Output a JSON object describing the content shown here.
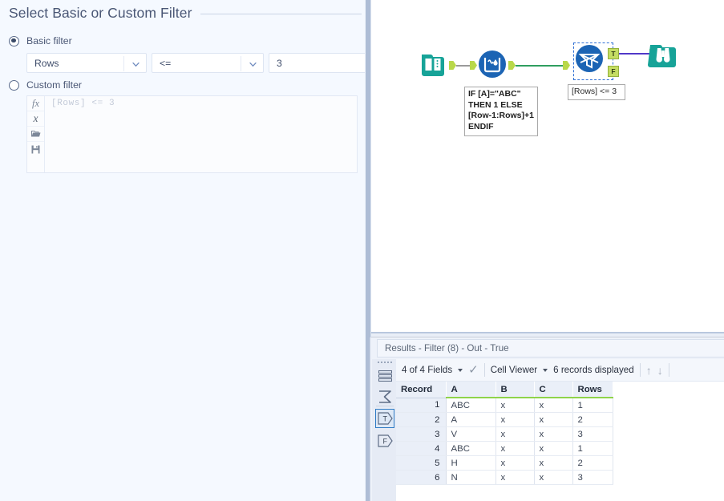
{
  "config_panel": {
    "section_title": "Select Basic or Custom Filter",
    "basic_radio_label": "Basic filter",
    "custom_radio_label": "Custom filter",
    "basic_filter": {
      "field": "Rows",
      "operator": "<=",
      "value": "3"
    },
    "custom_filter": {
      "expression_placeholder": "[Rows]  <=  3",
      "tools": [
        {
          "name": "fx-function-icon",
          "glyph": "fx"
        },
        {
          "name": "x-variable-icon",
          "glyph": "x"
        },
        {
          "name": "open-folder-icon",
          "glyph": "folder"
        },
        {
          "name": "save-disk-icon",
          "glyph": "disk"
        }
      ]
    }
  },
  "canvas": {
    "nodes": [
      {
        "id": "input-data",
        "icon": "input-data-book-icon",
        "color": "#17a398"
      },
      {
        "id": "multi-row-formula",
        "icon": "multi-row-formula-icon",
        "color": "#1c64b4"
      },
      {
        "id": "filter",
        "icon": "filter-funnel-icon",
        "color": "#1c64b4",
        "selected": true
      },
      {
        "id": "browse",
        "icon": "browse-binoculars-icon",
        "color": "#17a398"
      }
    ],
    "annotations": {
      "multi_row_formula": "IF [A]=\"ABC\"\nTHEN 1 ELSE\n[Row-1:Rows]+1\nENDIF",
      "filter": "[Rows] <= 3"
    },
    "filter_outputs": {
      "true_label": "T",
      "false_label": "F"
    }
  },
  "results": {
    "title": "Results - Filter (8) - Out - True",
    "sidebar": [
      {
        "name": "sidebar-records-icon",
        "label": ""
      },
      {
        "name": "sidebar-summary-sigma-icon",
        "label": ""
      },
      {
        "name": "sidebar-true-output-icon",
        "label": "T"
      },
      {
        "name": "sidebar-false-output-icon",
        "label": "F"
      }
    ],
    "toolbar": {
      "fields_label": "4 of 4 Fields",
      "viewer_label": "Cell Viewer",
      "records_label": "6 records displayed"
    },
    "table": {
      "columns": [
        "Record",
        "A",
        "B",
        "C",
        "Rows"
      ],
      "rows": [
        [
          "1",
          "ABC",
          "x",
          "x",
          "1"
        ],
        [
          "2",
          "A",
          "x",
          "x",
          "2"
        ],
        [
          "3",
          "V",
          "x",
          "x",
          "3"
        ],
        [
          "4",
          "ABC",
          "x",
          "x",
          "1"
        ],
        [
          "5",
          "H",
          "x",
          "x",
          "2"
        ],
        [
          "6",
          "N",
          "x",
          "x",
          "3"
        ]
      ]
    }
  },
  "colors": {
    "panel_bg": "#f5f9ff",
    "accent_blue": "#1c64b4",
    "accent_teal": "#17a398",
    "port_green": "#b9d84a",
    "header_underline_green": "#8fd44a",
    "selection_blue": "#2e6fd4"
  }
}
